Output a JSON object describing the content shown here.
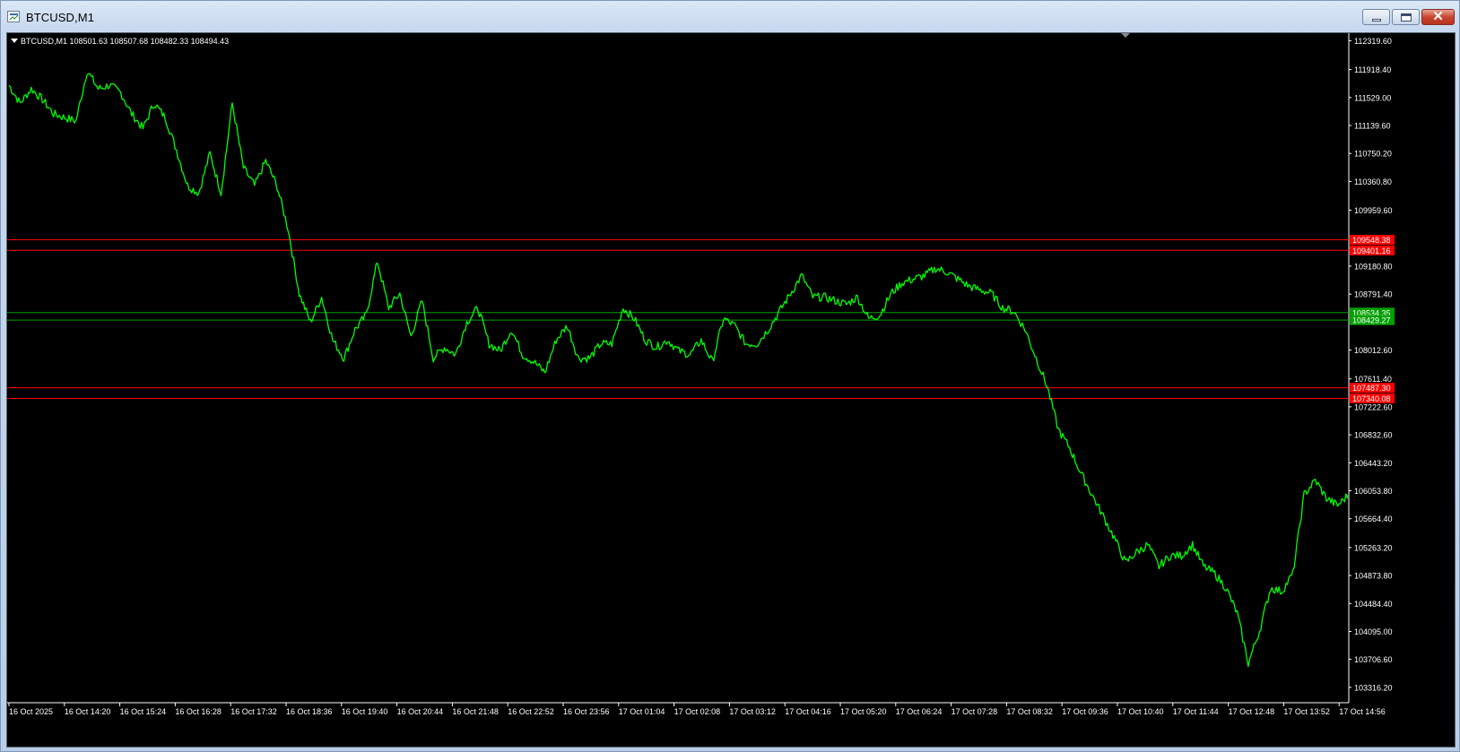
{
  "window": {
    "title": "BTCUSD,M1",
    "icon": "chart-window-icon",
    "close_glyph": "✕"
  },
  "chart_info": {
    "symbol_line": "BTCUSD,M1  108501.63 108507.68 108482.33 108494.43"
  },
  "colors": {
    "background": "#000000",
    "price_line": "#00ff00",
    "axis_text": "#ffffff",
    "red_level": "#ff0000",
    "green_level": "#00a000"
  },
  "chart_data": {
    "type": "line",
    "title": "",
    "xlabel": "",
    "ylabel": "",
    "ylim": [
      103140,
      112400
    ],
    "y_ticks": [
      "112319.60",
      "111918.40",
      "111529.00",
      "111139.60",
      "110750.20",
      "110360.80",
      "109959.60",
      "109180.80",
      "108791.40",
      "108012.60",
      "107611.40",
      "107222.60",
      "106832.60",
      "106443.20",
      "106053.80",
      "105664.40",
      "105263.20",
      "104873.80",
      "104484.40",
      "104095.00",
      "103706.60",
      "103316.20"
    ],
    "x_ticks": [
      "16 Oct 2025",
      "16 Oct 14:20",
      "16 Oct 15:24",
      "16 Oct 16:28",
      "16 Oct 17:32",
      "16 Oct 18:36",
      "16 Oct 19:40",
      "16 Oct 20:44",
      "16 Oct 21:48",
      "16 Oct 22:52",
      "16 Oct 23:56",
      "17 Oct 01:04",
      "17 Oct 02:08",
      "17 Oct 03:12",
      "17 Oct 04:16",
      "17 Oct 05:20",
      "17 Oct 06:24",
      "17 Oct 07:28",
      "17 Oct 08:32",
      "17 Oct 09:36",
      "17 Oct 10:40",
      "17 Oct 11:44",
      "17 Oct 12:48",
      "17 Oct 13:52",
      "17 Oct 14:56"
    ],
    "horizontal_levels": [
      {
        "value": 109548.38,
        "label": "109548.38",
        "color": "red"
      },
      {
        "value": 109401.16,
        "label": "109401.16",
        "color": "red"
      },
      {
        "value": 108534.35,
        "label": "108534.35",
        "color": "green"
      },
      {
        "value": 108429.27,
        "label": "108429.27",
        "color": "green"
      },
      {
        "value": 107487.3,
        "label": "107487.30",
        "color": "red"
      },
      {
        "value": 107340.08,
        "label": "107340.08",
        "color": "red"
      }
    ],
    "series": [
      {
        "values": [
          111700,
          111450,
          111650,
          111500,
          111300,
          111250,
          111200,
          111900,
          111650,
          111700,
          111600,
          111300,
          111100,
          111450,
          111250,
          110800,
          110300,
          110200,
          110750,
          110200,
          111450,
          110550,
          110300,
          110650,
          110300,
          109700,
          108800,
          108400,
          108750,
          108150,
          107900,
          108300,
          108500,
          109250,
          108600,
          108800,
          108200,
          108700,
          107900,
          108050,
          107950,
          108400,
          108600,
          108100,
          108000,
          108300,
          107950,
          107850,
          107700,
          108150,
          108350,
          107900,
          107900,
          108100,
          108100,
          108600,
          108450,
          108150,
          108050,
          108150,
          108000,
          107950,
          108150,
          107850,
          108450,
          108350,
          108100,
          108100,
          108300,
          108550,
          108800,
          109050,
          108750,
          108750,
          108700,
          108650,
          108750,
          108450,
          108500,
          108800,
          108950,
          109000,
          109050,
          109150,
          109100,
          109000,
          108900,
          108850,
          108800,
          108600,
          108550,
          108300,
          107900,
          107500,
          106900,
          106650,
          106300,
          106000,
          105700,
          105400,
          105050,
          105200,
          105300,
          105000,
          105150,
          105150,
          105300,
          105000,
          104900,
          104700,
          104350,
          103650,
          104100,
          104700,
          104650,
          104900,
          106000,
          106200,
          105950,
          105850,
          106000
        ]
      }
    ]
  }
}
